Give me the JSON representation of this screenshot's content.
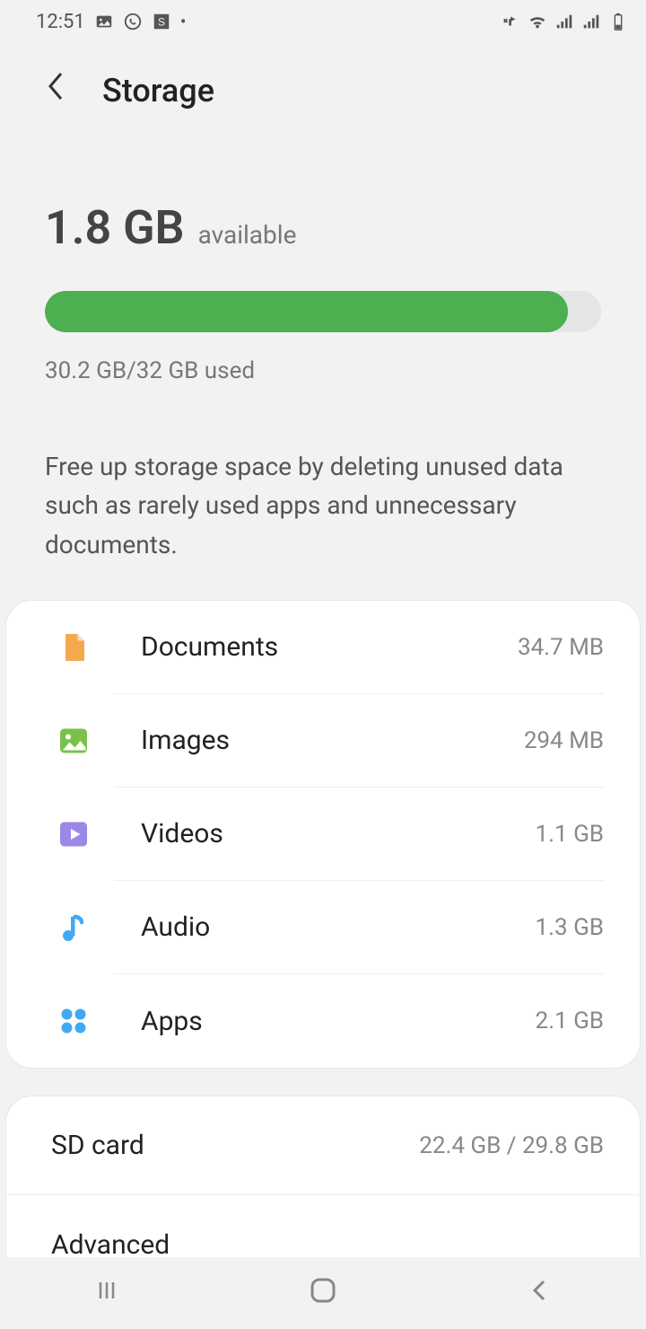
{
  "status": {
    "time": "12:51"
  },
  "header": {
    "title": "Storage"
  },
  "summary": {
    "available_size": "1.8 GB",
    "available_label": "available",
    "used_text": "30.2 GB/32 GB used",
    "progress_percent": 94
  },
  "tip": "Free up storage space by deleting unused data such as rarely used apps and unnecessary documents.",
  "categories": [
    {
      "label": "Documents",
      "size": "34.7 MB",
      "icon": "document",
      "color": "#f5a94f"
    },
    {
      "label": "Images",
      "size": "294 MB",
      "icon": "image",
      "color": "#7ac14b"
    },
    {
      "label": "Videos",
      "size": "1.1 GB",
      "icon": "video",
      "color": "#9b88e6"
    },
    {
      "label": "Audio",
      "size": "1.3 GB",
      "icon": "audio",
      "color": "#3fa9f5"
    },
    {
      "label": "Apps",
      "size": "2.1 GB",
      "icon": "apps",
      "color": "#3fa9f5"
    }
  ],
  "extra": {
    "sdcard_label": "SD card",
    "sdcard_value": "22.4 GB / 29.8 GB",
    "advanced_label": "Advanced"
  }
}
